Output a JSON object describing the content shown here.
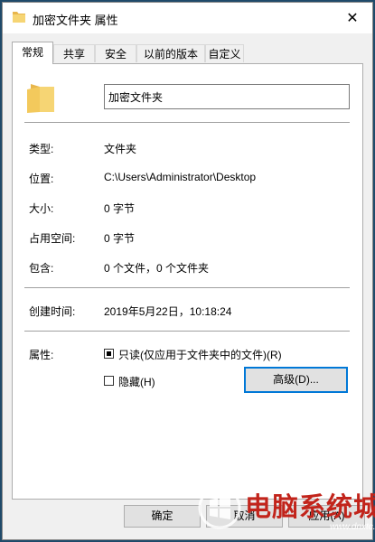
{
  "window": {
    "title": "加密文件夹 属性",
    "close_glyph": "✕",
    "icons": {
      "title": "folder-icon",
      "close": "close-icon"
    }
  },
  "tabs": [
    {
      "label": "常规",
      "active": true
    },
    {
      "label": "共享",
      "active": false
    },
    {
      "label": "安全",
      "active": false
    },
    {
      "label": "以前的版本",
      "active": false
    },
    {
      "label": "自定义",
      "active": false
    }
  ],
  "general": {
    "folder_name": "加密文件夹",
    "icon": "folder-icon",
    "fields": [
      {
        "label": "类型:",
        "value": "文件夹"
      },
      {
        "label": "位置:",
        "value": "C:\\Users\\Administrator\\Desktop"
      },
      {
        "label": "大小:",
        "value": "0 字节"
      },
      {
        "label": "占用空间:",
        "value": "0 字节"
      },
      {
        "label": "包含:",
        "value": "0 个文件，0 个文件夹"
      }
    ],
    "created": {
      "label": "创建时间:",
      "value": "2019年5月22日，10:18:24"
    },
    "attributes": {
      "label": "属性:",
      "readonly_label": "只读(仅应用于文件夹中的文件)(R)",
      "readonly_state": "indeterminate",
      "hidden_label": "隐藏(H)",
      "hidden_checked": false,
      "advanced_label": "高级(D)..."
    }
  },
  "footer": {
    "ok_label": "确定",
    "cancel_label": "取消",
    "apply_label": "应用(A)"
  },
  "watermark": {
    "text": "电脑系统城",
    "url": "www.dnxtc.net",
    "colors": {
      "text": "#c2241b",
      "accent": "#0078d7"
    }
  }
}
